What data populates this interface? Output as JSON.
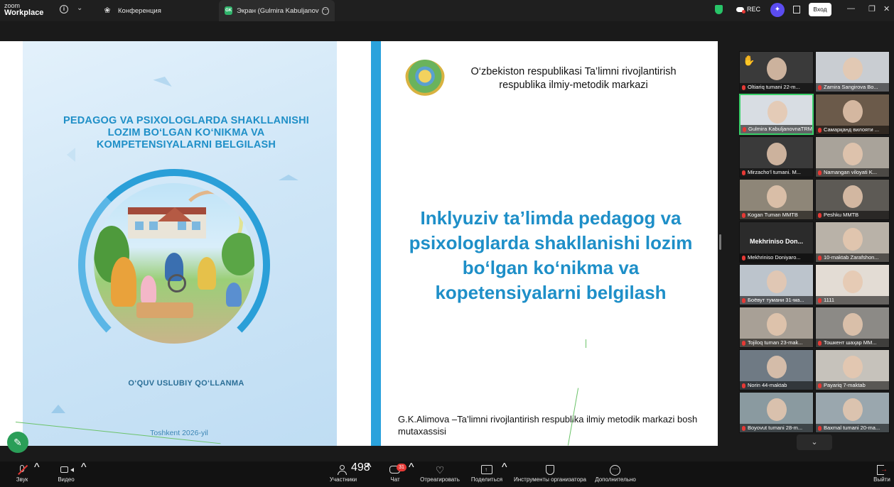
{
  "app": {
    "logo_top": "zoom",
    "logo_bottom": "Workplace"
  },
  "tabs": [
    {
      "label": "Конференция"
    },
    {
      "label": "Экран (Gulmira KabuljanovnaTRM",
      "badge": "GK"
    }
  ],
  "topbar": {
    "rec_label": "REC",
    "enter_label": "Вход",
    "minimize": "—",
    "restore": "❐",
    "close": "✕"
  },
  "slide": {
    "book_title": "PEDAGOG VA PSIXOLOGLARDA SHAKLLANISHI LOZIM BO‘LGAN KO‘NIKMA VA KOMPETENSIYALARNI BELGILASH",
    "book_subtitle": "O‘QUV USLUBIY QO‘LLANMA",
    "book_city": "Toshkent 2026-yil",
    "org": "O‘zbekiston respublikasi Ta’limni rivojlantirish respublika ilmiy-metodik markazi",
    "headline": "Inklyuziv ta’limda pedagog va psixologlarda shakllanishi lozim bo‘lgan ko‘nikma va kopetensiyalarni belgilash",
    "author": "G.K.Alimova –Ta’limni rivojlantirish respublika ilmiy metodik markazi bosh mutaxassisi"
  },
  "gallery": [
    {
      "name": "Oltiariq tumani 22-m...",
      "bg": "#3a3a3a",
      "hand": true
    },
    {
      "name": "Zamira Sangirova Bo...",
      "bg": "#c9cdd2"
    },
    {
      "name": "Gulmira KabuljanovnaTRM",
      "bg": "#d8dde3",
      "active": true
    },
    {
      "name": "Самарқанд вилояти ...",
      "bg": "#6b5a4a"
    },
    {
      "name": "Mirzacho‘l tumani. M...",
      "bg": "#3a3a3a"
    },
    {
      "name": "Namangan viloyati K...",
      "bg": "#a9a39a"
    },
    {
      "name": "Kogan Tuman MMTB",
      "bg": "#8e8678"
    },
    {
      "name": "Peshku MMTB",
      "bg": "#5d5a55"
    },
    {
      "name": "Mekhriniso Doniyaro...",
      "bg": "#2b2b2b",
      "display_name": "Mekhriniso Don..."
    },
    {
      "name": "10-maktab Zarafshon...",
      "bg": "#b9b2a8"
    },
    {
      "name": "Боёвут тумани 31-ма...",
      "bg": "#bcc4cc"
    },
    {
      "name": "1111",
      "bg": "#e3dcd4"
    },
    {
      "name": "Tojiloq tuman 23-mak...",
      "bg": "#a8a096"
    },
    {
      "name": "Тошкент шаҳар ММ...",
      "bg": "#8c8a86"
    },
    {
      "name": "Norin 44-maktab",
      "bg": "#6f7a84"
    },
    {
      "name": "Payariq 7-maktab",
      "bg": "#c6c2bb"
    },
    {
      "name": "Boyovut tumani 28-m...",
      "bg": "#8a9aa0"
    },
    {
      "name": "Baxmal tumani 20-ma...",
      "bg": "#9aa7ae"
    }
  ],
  "toolbar": {
    "audio": "Звук",
    "video": "Видео",
    "participants": "Участники",
    "participants_count": "498",
    "chat": "Чат",
    "chat_badge": "31",
    "react": "Отреагировать",
    "share": "Поделиться",
    "host_tools": "Инструменты организатора",
    "more": "Дополнительно",
    "leave": "Выйти"
  },
  "colors": {
    "accent_blue": "#1e8fc8",
    "active_green": "#3ad06a",
    "alert_red": "#e53935"
  }
}
